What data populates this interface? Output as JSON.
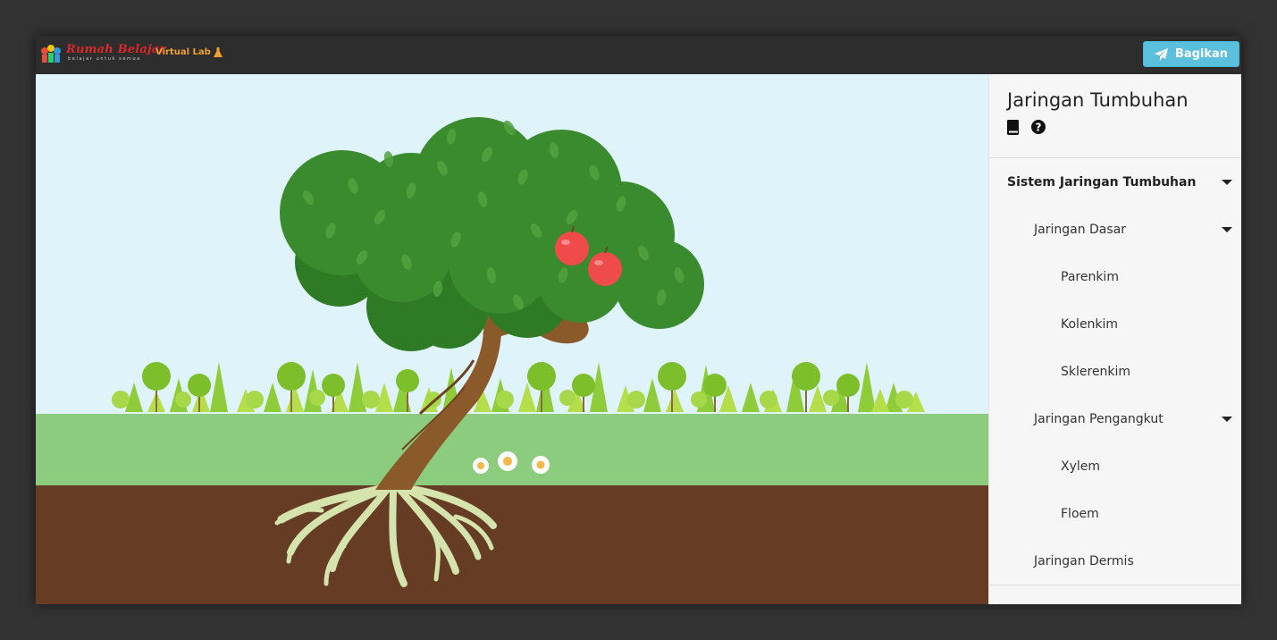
{
  "header": {
    "logo_title": "Rumah Belajar",
    "logo_tagline": "belajar untuk semua",
    "virtual_lab": "Virtual Lab",
    "share_label": "Bagikan"
  },
  "panel": {
    "title": "Jaringan Tumbuhan",
    "menu": [
      {
        "label": "Sistem Jaringan Tumbuhan",
        "level": 0,
        "expanded": true
      },
      {
        "label": "Jaringan Dasar",
        "level": 1,
        "expanded": true
      },
      {
        "label": "Parenkim",
        "level": 2
      },
      {
        "label": "Kolenkim",
        "level": 2
      },
      {
        "label": "Sklerenkim",
        "level": 2
      },
      {
        "label": "Jaringan Pengangkut",
        "level": 1,
        "expanded": true
      },
      {
        "label": "Xylem",
        "level": 2
      },
      {
        "label": "Floem",
        "level": 2
      },
      {
        "label": "Jaringan Dermis",
        "level": 1
      }
    ]
  },
  "icons": {
    "book": "book-icon",
    "help": "question-circle-icon",
    "share": "paper-plane-icon",
    "flask": "flask-icon"
  },
  "colors": {
    "sky": "#dff3fa",
    "grass": "#8ccc7f",
    "soil": "#663d24",
    "canopy": "#3a8a2e",
    "trunk": "#8b5a2b",
    "roots": "#d8e6b0",
    "apple": "#ef4b4b",
    "share_button": "#5bc0de",
    "logo_red": "#d8282c",
    "virtual_lab": "#f0a030"
  }
}
